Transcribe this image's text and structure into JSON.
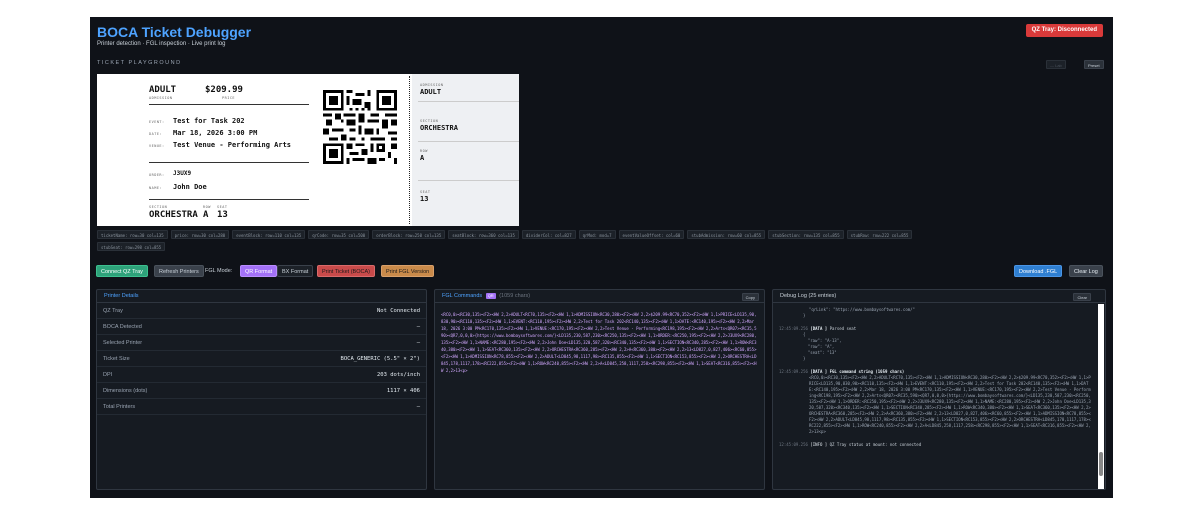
{
  "header": {
    "title": "BOCA Ticket Debugger",
    "subtitle": "Printer detection · FGL inspection · Live print log",
    "status": "QZ Tray: Disconnected"
  },
  "playground": {
    "title": "TICKET PLAYGROUND",
    "preset_disabled_label": "— Lab",
    "preset_label": "Preset"
  },
  "ticket": {
    "admission_value": "ADULT",
    "admission_label": "ADMISSION",
    "price_value": "$209.99",
    "price_label": "PRICE",
    "event_label": "EVENT:",
    "event_value": "Test for Task 202",
    "date_label": "DATE:",
    "date_value": "Mar 18, 2026 3:00 PM",
    "venue_label": "VENUE:",
    "venue_value": "Test Venue - Performing Arts",
    "order_label": "ORDER:",
    "order_value": "J3UX9",
    "name_label": "NAME:",
    "name_value": "John Doe",
    "section_label": "SECTION",
    "row_label": "ROW",
    "seat_label": "SEAT",
    "section_value": "ORCHESTRA",
    "row_value": "A",
    "seat_value": "13",
    "stub": {
      "admission_label": "ADMISSION",
      "admission_value": "ADULT",
      "section_label": "SECTION",
      "section_value": "ORCHESTRA",
      "row_label": "ROW",
      "row_value": "A",
      "seat_label": "SEAT",
      "seat_value": "13"
    }
  },
  "layout_tags": [
    "ticketName: row=30 col=135",
    "price: row=30 col=280",
    "eventBlock: row=110 col=135",
    "qrCode: row=35 col=500",
    "orderBlock: row=250 col=135",
    "seatBlock: row=360 col=135",
    "dividerCol: col=827",
    "qrMod: mod=7",
    "eventValueOffset: col=60",
    "stubAdmission: row=60 col=855",
    "stubSection: row=135 col=855",
    "stubRow: row=222 col=855",
    "stubSeat: row=298 col=855"
  ],
  "toolbar": {
    "connect": "Connect QZ Tray",
    "refresh": "Refresh Printers",
    "fgl_mode_label": "FGL Mode:",
    "qr_format": "QR Format",
    "bx_format": "BX Format",
    "print_ticket": "Print Ticket (BOCA)",
    "print_fgl": "Print FGL Version",
    "download": "Download .FGL",
    "clear_log": "Clear Log"
  },
  "printer_details": {
    "title": "Printer Details",
    "rows": [
      {
        "k": "QZ Tray",
        "v": "Not Connected"
      },
      {
        "k": "BOCA Detected",
        "v": "—"
      },
      {
        "k": "Selected Printer",
        "v": "—"
      },
      {
        "k": "Ticket Size",
        "v": "BOCA_GENERIC (5.5\" × 2\")"
      },
      {
        "k": "DPI",
        "v": "203 dots/inch"
      },
      {
        "k": "Dimensions (dots)",
        "v": "1117 × 406"
      },
      {
        "k": "Total Printers",
        "v": "—"
      }
    ]
  },
  "fgl": {
    "title": "FGL Commands",
    "badge": "QR",
    "count": "(1059 chars)",
    "copy": "Copy",
    "text": "<RC0,0><RC30,135><F2><HW 2,2>ADULT<RC70,135><F2><HW 1,1>ADMISSION<RC30,280><F2><HW 2,2>$209.99<RC70,352><F2><HW 1,1>PRICE<LD135,90,830,90><RC110,135><F2><HW 1,1>EVENT:<RC110,195><F2><HW 2,2>Test for Task 202<RC140,135><F2><HW 1,1>DATE:<RC140,195><F2><HW 2,2>Mar 18, 2026 3:00 PM<RC170,135><F2><HW 1,1>VENUE:<RC170,195><F2><HW 2,2>Test Venue - Performing<RC198,195><F2><HW 2,2>Arts<QR07><RC35,590><QR7,0,0,0>{https://www.bombaysoftwares.com/}<LD135,230,587,230><RC250,135><F2><HW 1,1>ORDER:<RC250,195><F2><HW 2,2>J3UX9<RC280,135><F2><HW 1,1>NAME:<RC280,195><F2><HW 2,2>John Doe<LD135,320,587,320><RC340,135><F2><HW 1,1>SECTION<RC340,285><F2><HW 1,1>ROW<RC340,380><F2><HW 1,1>SEAT<RC360,135><F2><HW 2,2>ORCHESTRA<RC360,285><F2><HW 2,2>A<RC360,380><F2><HW 2,2>13<LD827,0,827,406><RC60,855><F2><HW 1,1>ADMISSION<RC78,855><F2><HW 2,2>ADULT<LD845,98,1117,98><RC135,855><F2><HW 1,1>SECTION<RC153,855><F2><HW 2,2>ORCHESTRA<LD845,178,1117,178><RC222,855><F2><HW 1,1>ROW<RC240,855><F2><HW 2,2>A<LD845,258,1117,258><RC298,855><F2><HW 1,1>SEAT<RC316,855><F2><HW 2,2>13<p>"
  },
  "debug": {
    "title": "Debug Log (25 entries)",
    "clear": "Clear",
    "qr_link_line": "\"qrLink\": \"https://www.bombaysoftwares.com/\"",
    "close_brace": "}",
    "entries": {
      "e1_ts": "12:45:09.256",
      "e1_tag": "[DATA ]",
      "e1_msg": "Parsed seat",
      "e1_json": "{\n  \"raw\": \"A-13\",\n  \"row\": \"A\",\n  \"seat\": \"13\"\n}",
      "e2_ts": "12:45:09.256",
      "e2_tag": "[DATA ]",
      "e2_msg": "FGL command string (1059 chars)",
      "e2_text": "<RC0,0><RC30,135><F2><HW 2,2>ADULT<RC70,135><F2><HW 1,1>ADMISSION<RC30,280><F2><HW 2,2>$209.99<RC70,352><F2><HW 1,1>PRICE<LD135,90,830,90><RC110,135><F2><HW 1,1>EVENT:<RC110,195><F2><HW 2,2>Test for Task 202<RC140,135><F2><HW 1,1>DATE:<RC140,195><F2><HW 2,2>Mar 18, 2026 3:00 PM<RC170,135><F2><HW 1,1>VENUE:<RC170,195><F2><HW 2,2>Test Venue - Performing<RC198,195><F2><HW 2,2>Arts<QR07><RC35,590><QR7,0,0,0>{https://www.bombaysoftwares.com/}<LD135,230,587,230><RC250,135><F2><HW 1,1>ORDER:<RC250,195><F2><HW 2,2>J3UX9<RC280,135><F2><HW 1,1>NAME:<RC280,195><F2><HW 2,2>John Doe<LD135,320,587,320><RC340,135><F2><HW 1,1>SECTION<RC340,285><F2><HW 1,1>ROW<RC340,380><F2><HW 1,1>SEAT<RC360,135><F2><HW 2,2>ORCHESTRA<RC360,285><F2><HW 2,2>A<RC360,380><F2><HW 2,2>13<LD827,0,827,406><RC60,855><F2><HW 1,1>ADMISSION<RC78,855><F2><HW 2,2>ADULT<LD845,98,1117,98><RC135,855><F2><HW 1,1>SECTION<RC153,855><F2><HW 2,2>ORCHESTRA<LD845,178,1117,178><RC222,855><F2><HW 1,1>ROW<RC240,855><F2><HW 2,2>A<LD845,258,1117,258><RC298,855><F2><HW 1,1>SEAT<RC316,855><F2><HW 2,2>13<p>",
      "e3_ts": "12:45:09.256",
      "e3_tag": "[INFO ]",
      "e3_msg": "QZ Tray status at mount: not connected"
    }
  },
  "colors": {
    "background": "#0f1218",
    "accent": "#4ea3ff",
    "status_error": "#d93a3a",
    "connect_green": "#2ea27a",
    "qr_purple": "#a371f7",
    "print_red": "#c94a4a",
    "print_orange": "#c98a4a",
    "download_blue": "#2f7fd1"
  },
  "icons": [
    "qr-code-icon",
    "scrollbar"
  ]
}
